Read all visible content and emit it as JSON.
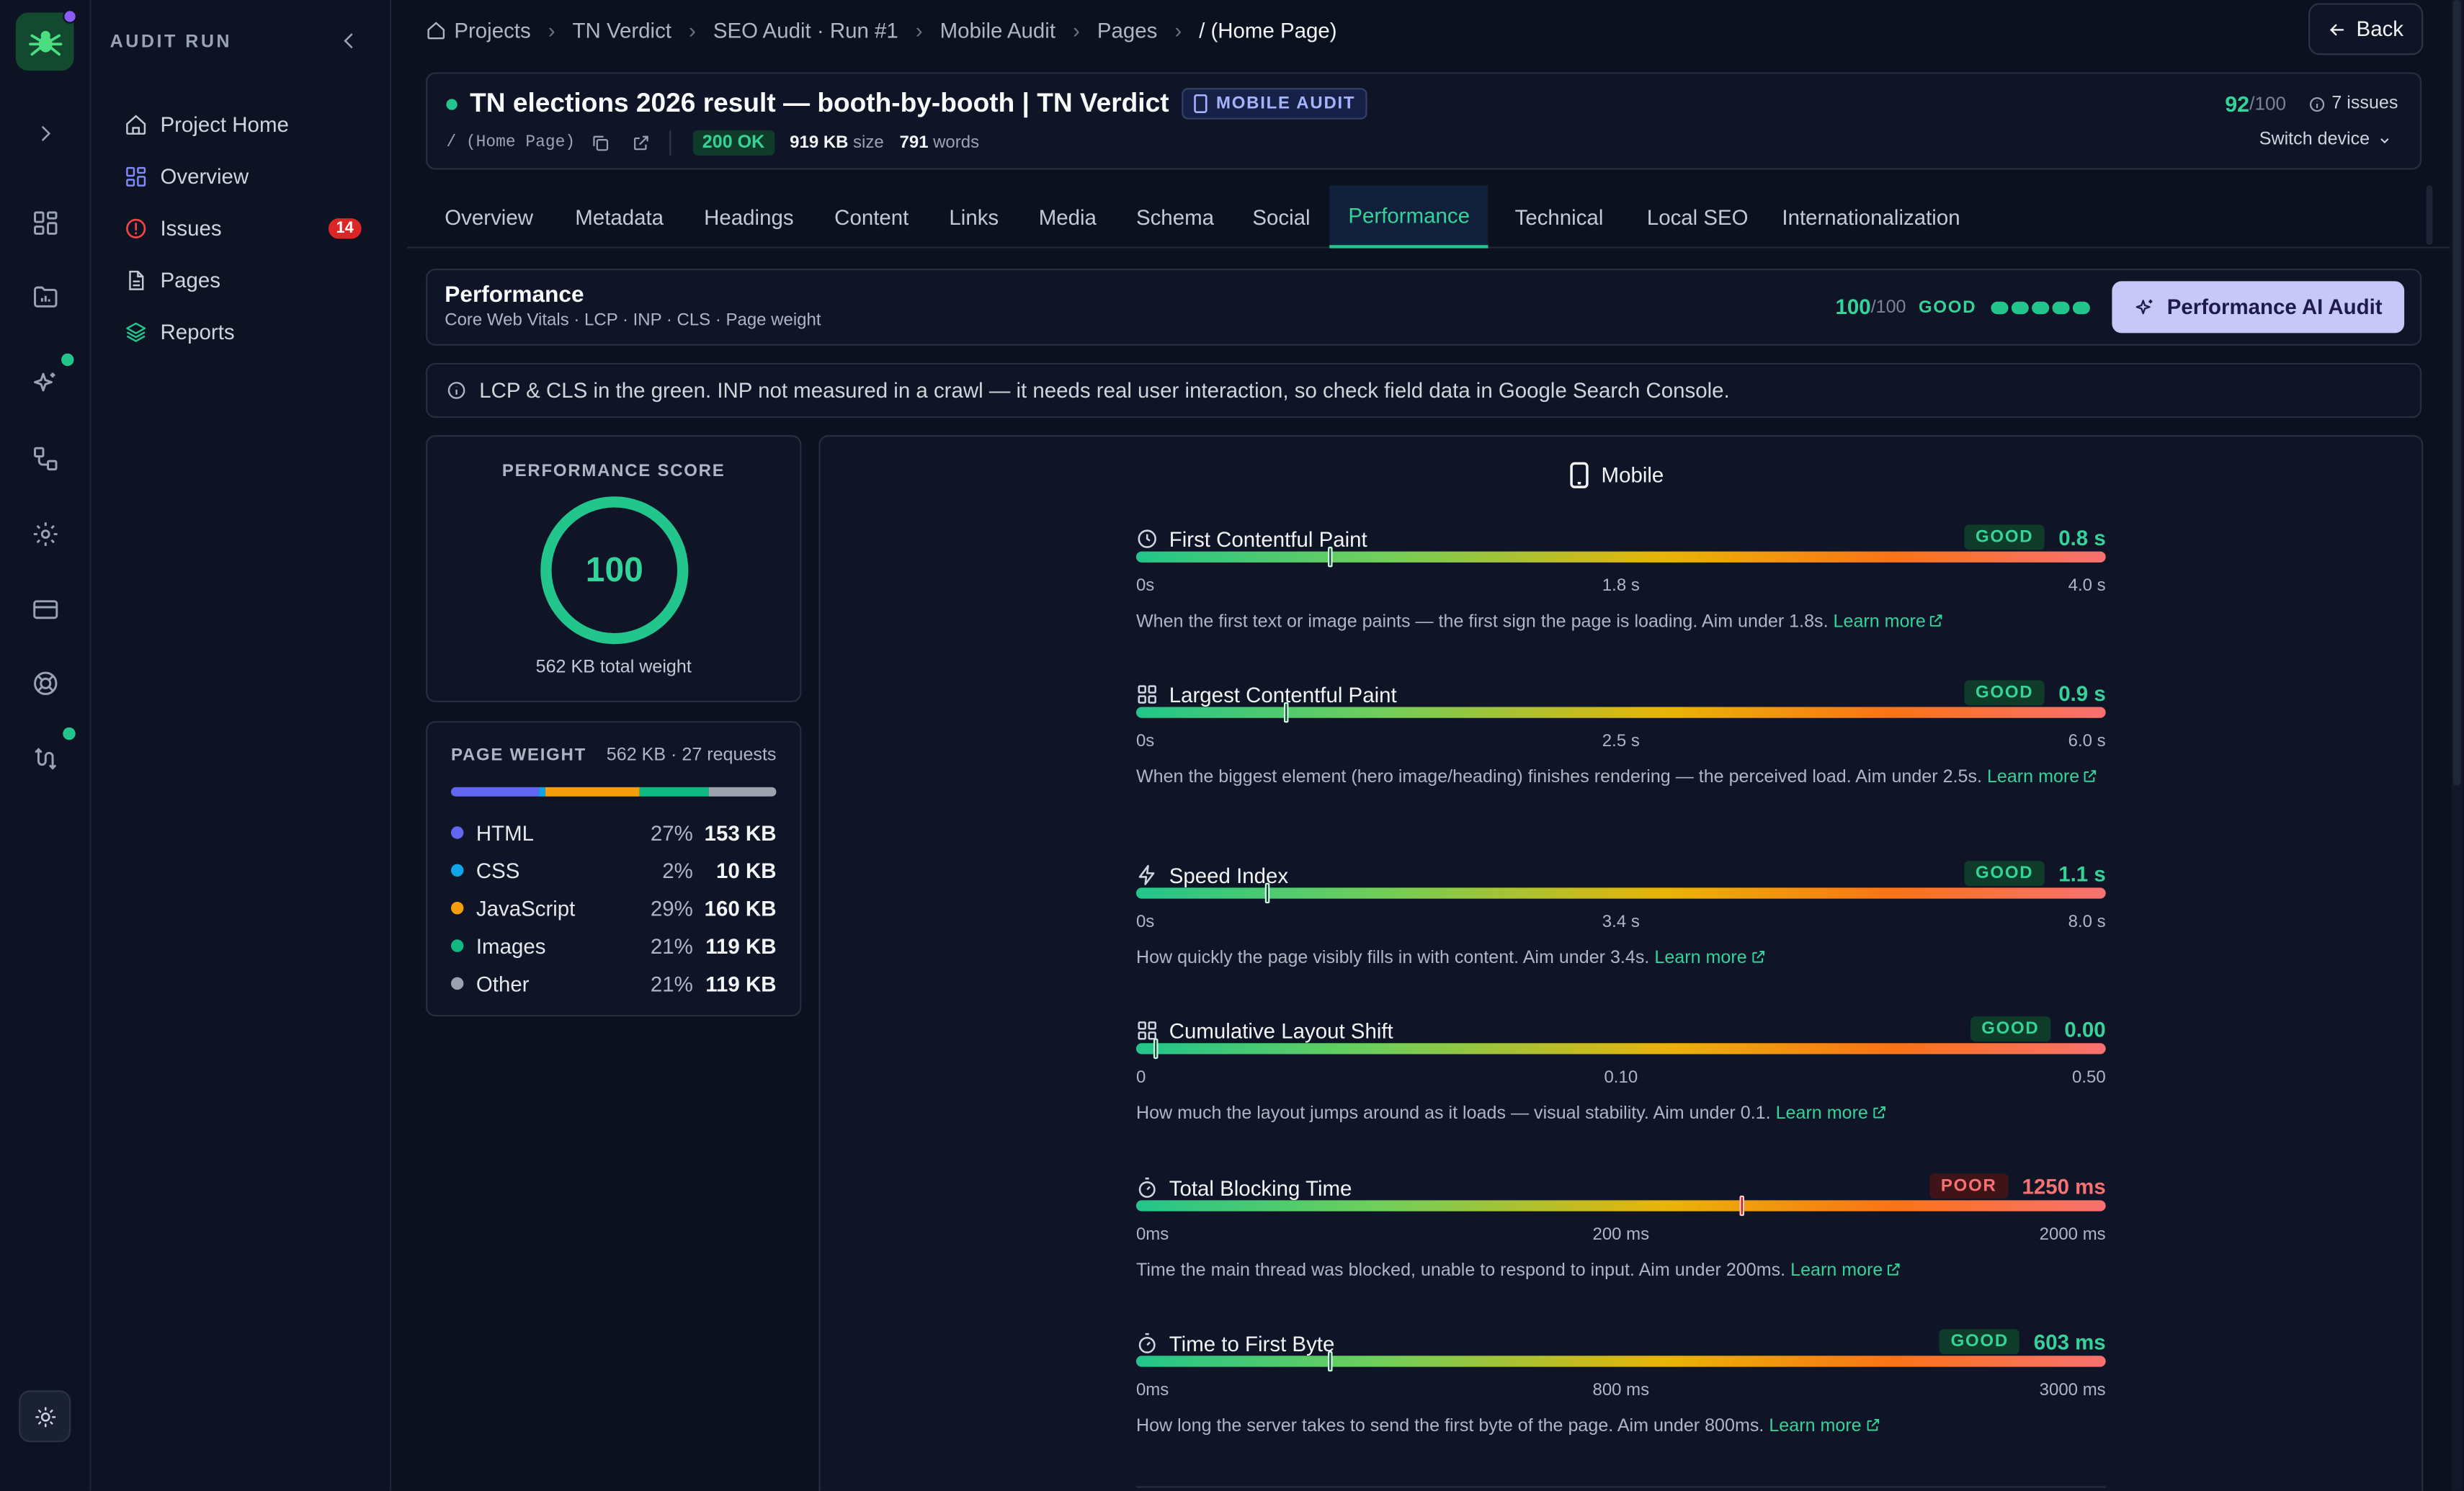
{
  "sidebar": {
    "heading": "AUDIT RUN",
    "items": [
      {
        "label": "Project Home"
      },
      {
        "label": "Overview"
      },
      {
        "label": "Issues",
        "badge": "14"
      },
      {
        "label": "Pages"
      },
      {
        "label": "Reports"
      }
    ]
  },
  "breadcrumb": [
    "Projects",
    "TN Verdict",
    "SEO Audit · Run #1",
    "Mobile Audit",
    "Pages",
    "/ (Home Page)"
  ],
  "back_label": "Back",
  "page": {
    "title": "TN elections 2026 result — booth-by-booth | TN Verdict",
    "audit_badge": "MOBILE AUDIT",
    "path": "/ (Home Page)",
    "status": "200 OK",
    "size_value": "919 KB",
    "size_label": "size",
    "words_value": "791",
    "words_label": "words",
    "score": "92",
    "score_max": "/100",
    "issues": "7 issues",
    "switch_device": "Switch device"
  },
  "tabs": [
    "Overview",
    "Metadata",
    "Headings",
    "Content",
    "Links",
    "Media",
    "Schema",
    "Social",
    "Performance",
    "Technical",
    "Local SEO",
    "Internationalization"
  ],
  "active_tab": "Performance",
  "performance": {
    "title": "Performance",
    "subtitle": "Core Web Vitals · LCP · INP · CLS · Page weight",
    "score": "100",
    "score_max": "/100",
    "rating": "GOOD",
    "ai_button": "Performance AI Audit",
    "note": "LCP & CLS in the green. INP not measured in a crawl — it needs real user interaction, so check field data in Google Search Console."
  },
  "score_card": {
    "label": "PERFORMANCE SCORE",
    "value": "100",
    "fraction": 1.0,
    "total_weight": "562 KB total weight"
  },
  "page_weight": {
    "label": "PAGE WEIGHT",
    "summary": "562 KB · 27 requests",
    "items": [
      {
        "name": "HTML",
        "pct": "27%",
        "size": "153 KB",
        "share": 27,
        "color": "#6366f1"
      },
      {
        "name": "CSS",
        "pct": "2%",
        "size": "10 KB",
        "share": 2,
        "color": "#0ea5e9"
      },
      {
        "name": "JavaScript",
        "pct": "29%",
        "size": "160 KB",
        "share": 29,
        "color": "#f59e0b"
      },
      {
        "name": "Images",
        "pct": "21%",
        "size": "119 KB",
        "share": 21,
        "color": "#10b981"
      },
      {
        "name": "Other",
        "pct": "21%",
        "size": "119 KB",
        "share": 21,
        "color": "#9ca3af"
      }
    ]
  },
  "device_label": "Mobile",
  "metrics": [
    {
      "name": "First Contentful Paint",
      "icon": "clock-icon",
      "rating": "GOOD",
      "value": "0.8 s",
      "position": 0.2,
      "ticks": [
        "0s",
        "1.8 s",
        "4.0 s"
      ],
      "desc": "When the first text or image paints — the first sign the page is loading. Aim under 1.8s.",
      "link": "Learn more"
    },
    {
      "name": "Largest Contentful Paint",
      "icon": "grid-icon",
      "rating": "GOOD",
      "value": "0.9 s",
      "position": 0.155,
      "ticks": [
        "0s",
        "2.5 s",
        "6.0 s"
      ],
      "desc": "When the biggest element (hero image/heading) finishes rendering — the perceived load. Aim under 2.5s.",
      "link": "Learn more"
    },
    {
      "name": "Speed Index",
      "icon": "lightning-icon",
      "rating": "GOOD",
      "value": "1.1 s",
      "position": 0.135,
      "ticks": [
        "0s",
        "3.4 s",
        "8.0 s"
      ],
      "desc": "How quickly the page visibly fills in with content. Aim under 3.4s.",
      "link": "Learn more"
    },
    {
      "name": "Cumulative Layout Shift",
      "icon": "grid-icon",
      "rating": "GOOD",
      "value": "0.00",
      "position": 0.02,
      "ticks": [
        "0",
        "0.10",
        "0.50"
      ],
      "desc": "How much the layout jumps around as it loads — visual stability. Aim under 0.1.",
      "link": "Learn more"
    },
    {
      "name": "Total Blocking Time",
      "icon": "stopwatch-icon",
      "rating": "POOR",
      "value": "1250 ms",
      "position": 0.625,
      "ticks": [
        "0ms",
        "200 ms",
        "2000 ms"
      ],
      "desc": "Time the main thread was blocked, unable to respond to input. Aim under 200ms.",
      "link": "Learn more"
    },
    {
      "name": "Time to First Byte",
      "icon": "stopwatch-icon",
      "rating": "GOOD",
      "value": "603 ms",
      "position": 0.2,
      "ticks": [
        "0ms",
        "800 ms",
        "3000 ms"
      ],
      "desc": "How long the server takes to send the first byte of the page. Aim under 800ms.",
      "link": "Learn more"
    }
  ]
}
